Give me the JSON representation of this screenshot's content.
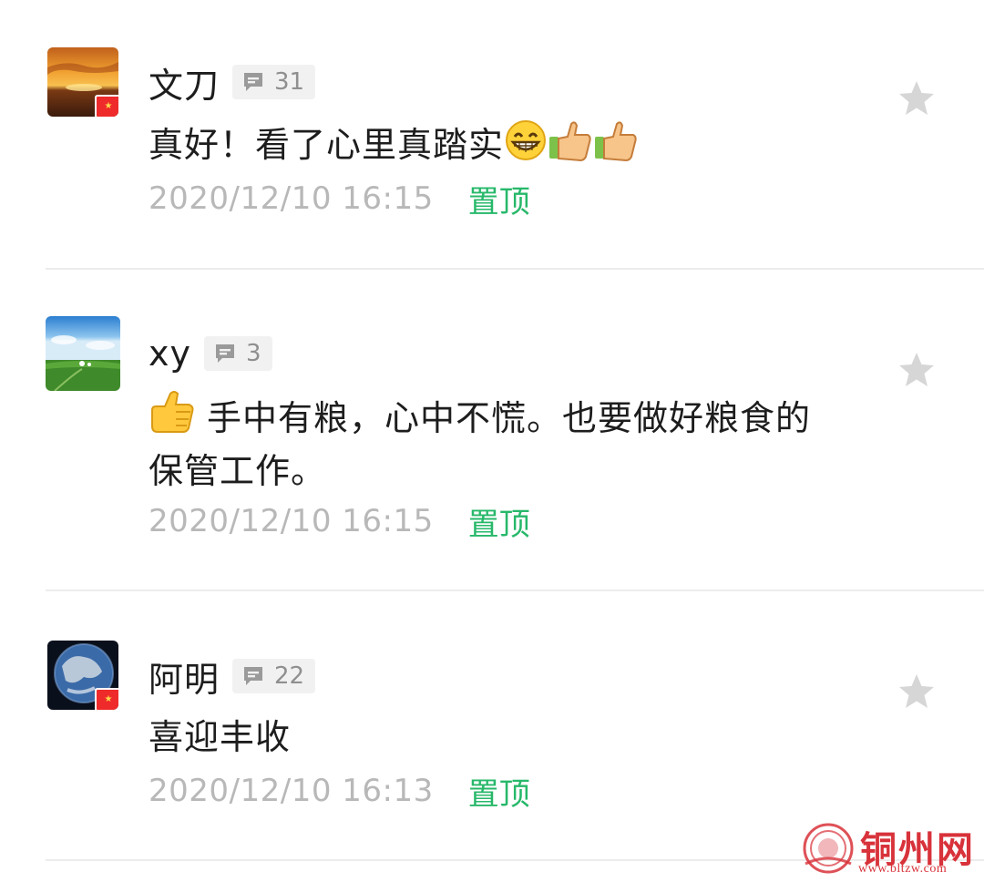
{
  "comments": [
    {
      "name": "文刀",
      "reply_count": "31",
      "text": "真好！看了心里真踏实",
      "emojis": [
        "grinning-emoji",
        "thumbs-up-emoji",
        "thumbs-up-emoji"
      ],
      "time": "2020/12/10 16:15",
      "pin_label": "置顶",
      "avatar": "sunset-avatar",
      "has_flag": true
    },
    {
      "name": "xy",
      "reply_count": "3",
      "text_line1": "手中有粮，心中不慌。也要做好粮食的",
      "text_line2": "保管工作。",
      "emojis": [
        "thumbs-up-emoji"
      ],
      "time": "2020/12/10 16:15",
      "pin_label": "置顶",
      "avatar": "grassland-avatar",
      "has_flag": false
    },
    {
      "name": "阿明",
      "reply_count": "22",
      "text": "喜迎丰收",
      "time": "2020/12/10 16:13",
      "pin_label": "置顶",
      "avatar": "earth-avatar",
      "has_flag": true
    }
  ],
  "watermark": {
    "name": "铜州网",
    "url": "www.bltzw.com"
  },
  "colors": {
    "accent_green": "#27b86a",
    "time_gray": "#b8b8b8",
    "badge_bg": "#f1f1f1",
    "star_gray": "#d6d6d6",
    "watermark_red": "#d8323a"
  }
}
